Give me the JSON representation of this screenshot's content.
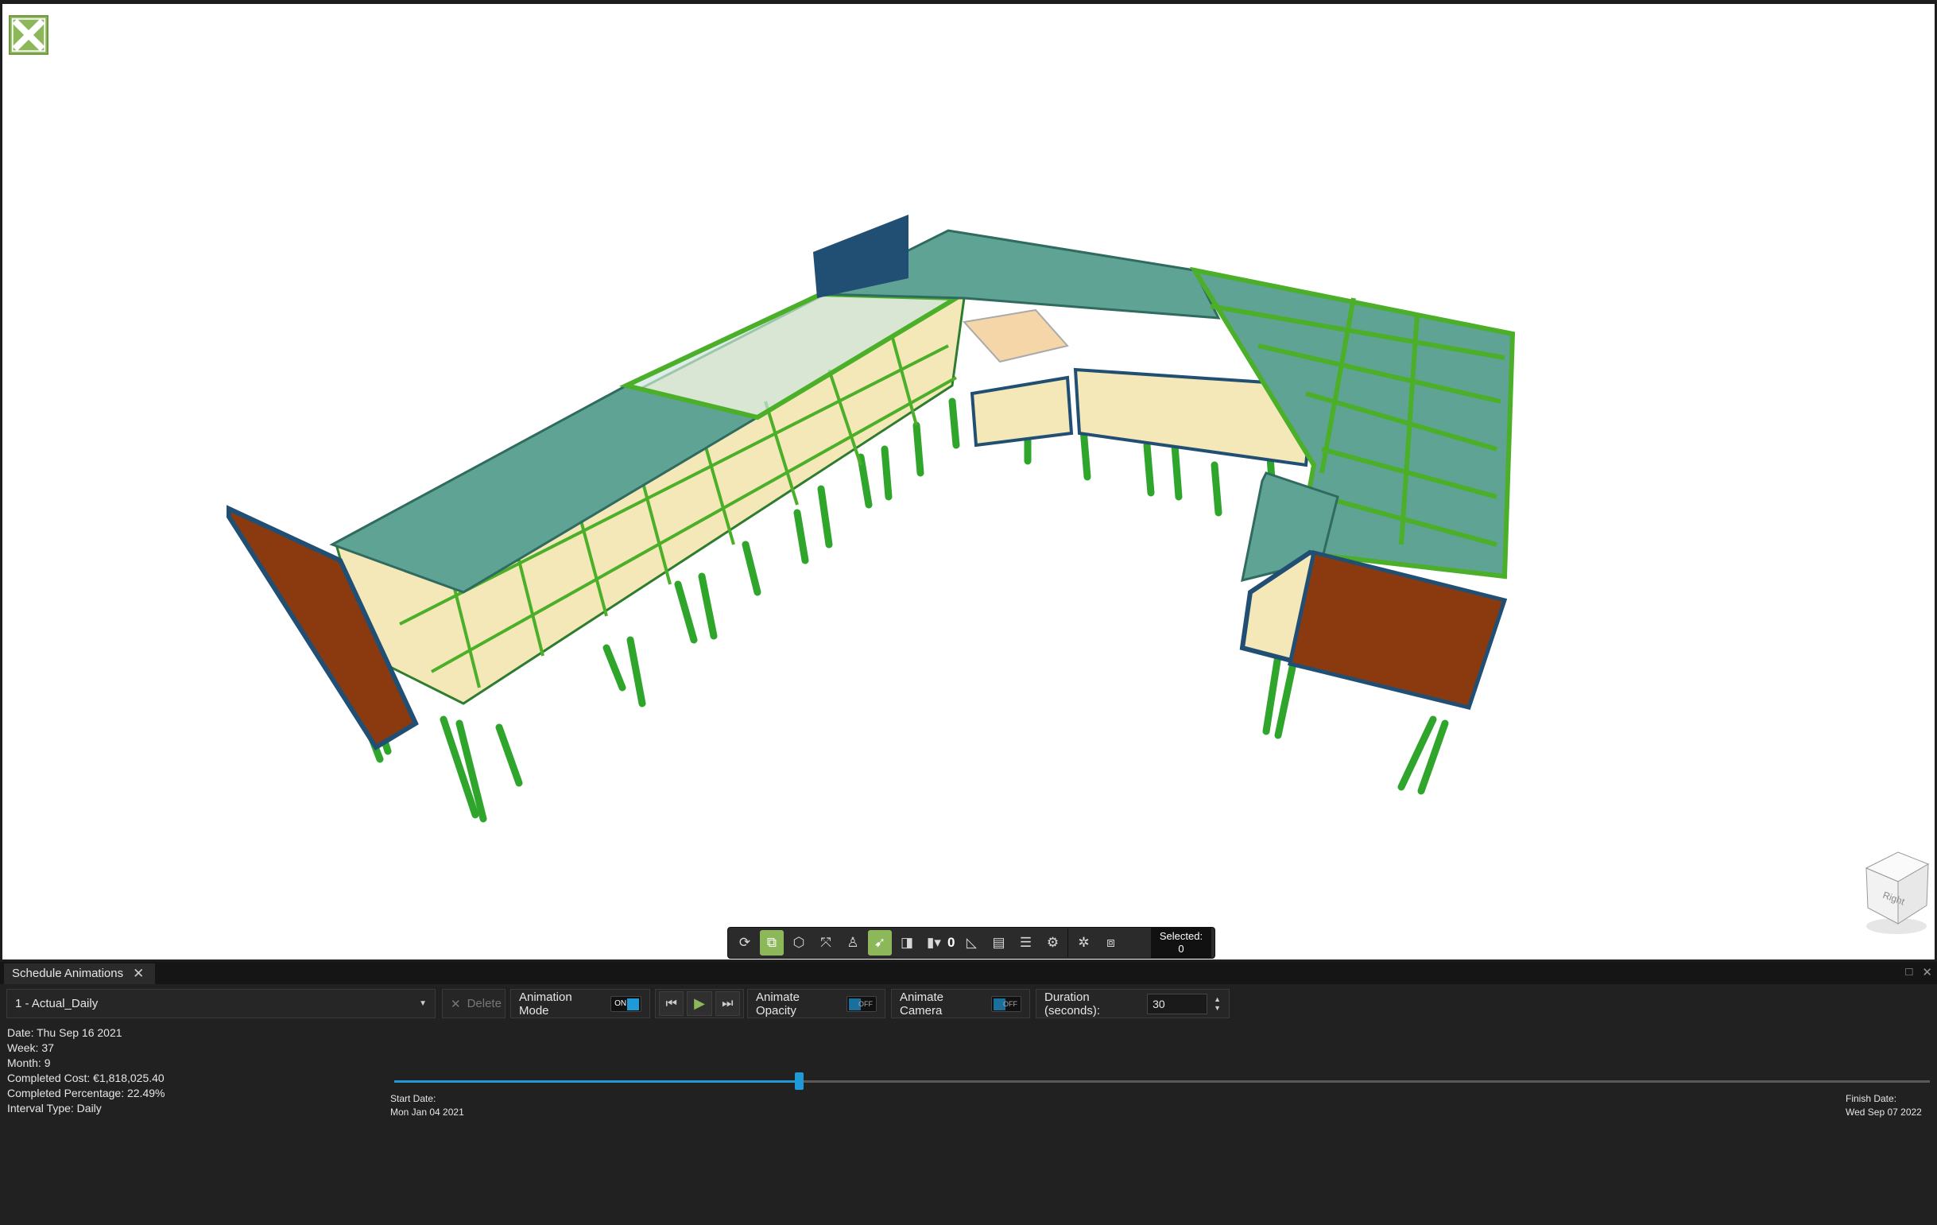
{
  "toolbar": {
    "count": "0",
    "selected_label": "Selected:",
    "selected_value": "0",
    "icons": [
      "rotate-icon",
      "select-box-icon",
      "isolate-icon",
      "fit-icon",
      "walk-icon",
      "pick-icon",
      "section-icon",
      "hide-icon",
      "measure-icon",
      "layers-icon",
      "properties-icon",
      "settings-icon",
      "explode-icon",
      "cube-icon"
    ]
  },
  "view_cube": {
    "face_label": "Right"
  },
  "panel": {
    "tab_label": "Schedule Animations",
    "schedule": "1 - Actual_Daily",
    "delete_label": "Delete",
    "animation_mode_label": "Animation Mode",
    "animation_mode_state": "ON",
    "animate_opacity_label": "Animate Opacity",
    "animate_opacity_state": "OFF",
    "animate_camera_label": "Animate Camera",
    "animate_camera_state": "OFF",
    "duration_label": "Duration (seconds):",
    "duration_value": "30"
  },
  "info": {
    "date": "Date: Thu Sep 16 2021",
    "week": "Week: 37",
    "month": "Month: 9",
    "cost": "Completed Cost: €1,818,025.40",
    "percentage": "Completed Percentage: 22.49%",
    "interval": "Interval Type: Daily"
  },
  "timeline": {
    "start_label": "Start Date:",
    "start_date": "Mon Jan 04 2021",
    "finish_label": "Finish Date:",
    "finish_date": "Wed Sep 07 2022",
    "progress": 0.2637
  },
  "colors": {
    "accent": "#8cb85a",
    "slider": "#1f9ad6",
    "slab": "#5fa394",
    "beam": "#4caf2a",
    "facade_brown": "#8b3a10",
    "glazing": "#f2e6b0"
  }
}
